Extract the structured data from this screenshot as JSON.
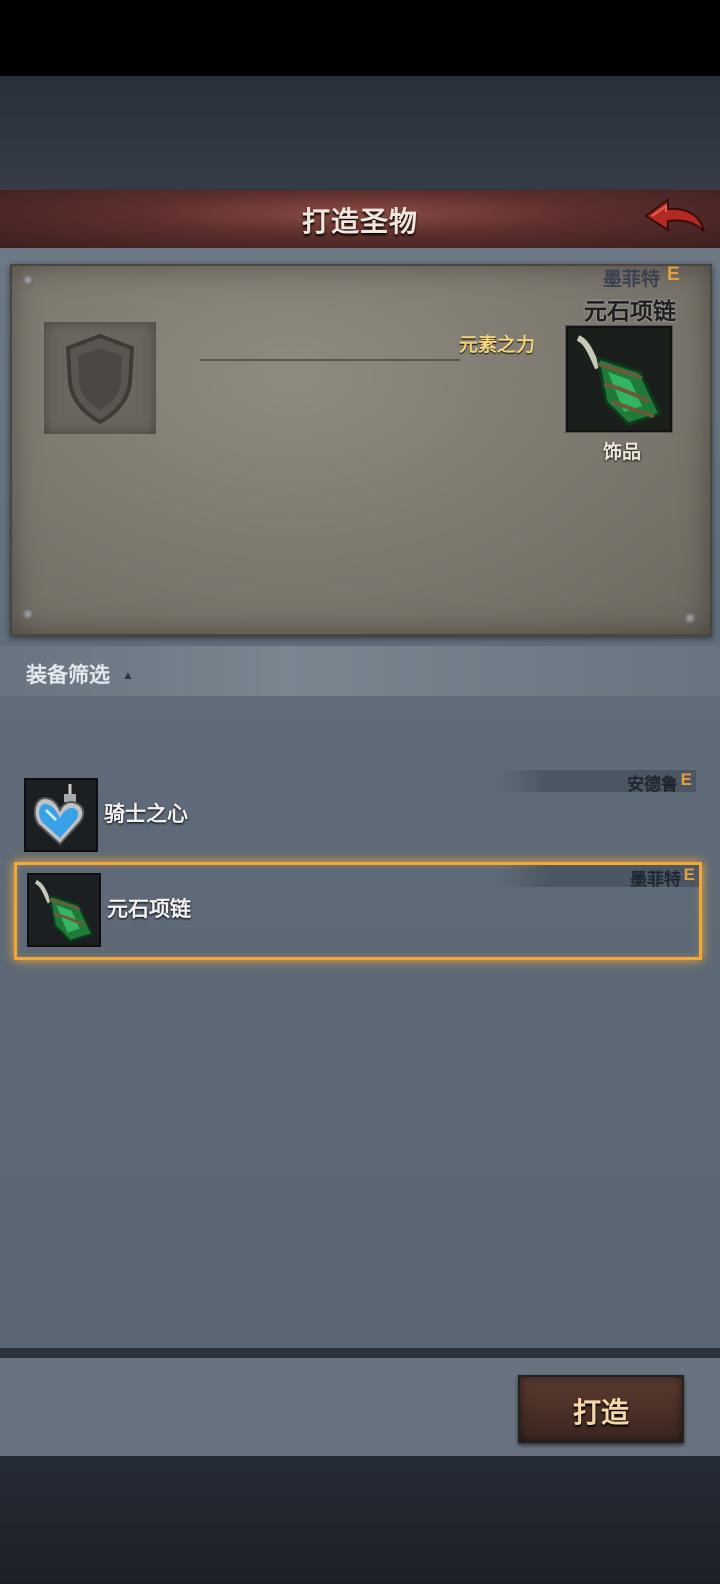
{
  "header": {
    "title": "打造圣物"
  },
  "preview": {
    "hero_name": "墨菲特",
    "hero_rank": "E",
    "item_name": "元石项链",
    "stat_label": "元素之力",
    "item_type": "饰品"
  },
  "filter": {
    "label": "装备筛选",
    "caret": "▲"
  },
  "items": [
    {
      "name": "骑士之心",
      "owner": "安德鲁",
      "rank": "E",
      "icon": "heart-pendant-icon",
      "selected": false
    },
    {
      "name": "元石项链",
      "owner": "墨菲特",
      "rank": "E",
      "icon": "green-crystal-necklace-icon",
      "selected": true
    }
  ],
  "actions": {
    "forge_label": "打造"
  },
  "colors": {
    "rank": "#e0a040",
    "selection": "#f0a838",
    "title_bar": "#5c2e2c"
  }
}
